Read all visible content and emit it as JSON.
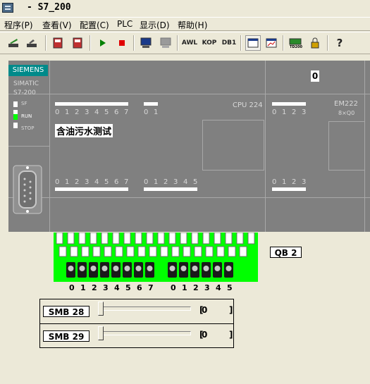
{
  "window": {
    "title": "- S7_200"
  },
  "menu": [
    {
      "label": "程序(P)"
    },
    {
      "label": "查看(V)"
    },
    {
      "label": "配置(C)"
    },
    {
      "label": "PLC"
    },
    {
      "label": "显示(D)"
    },
    {
      "label": "帮助(H)"
    }
  ],
  "toolbar": {
    "awl": "AWL",
    "kop": "KOP",
    "db1": "DB1",
    "td": "TD200",
    "help": "?"
  },
  "plc": {
    "brand": "SIEMENS",
    "model_line1": "SIMATIC",
    "model_line2": "S7-200",
    "status": {
      "sf": "SF",
      "run": "RUN",
      "stop": "STOP"
    },
    "cpu": "CPU 224",
    "program_name": "含油污水测试",
    "inputs_group1": [
      "0",
      "1",
      "2",
      "3",
      "4",
      "5",
      "6",
      "7"
    ],
    "inputs_group2": [
      "0",
      "1"
    ],
    "outputs_group1": [
      "0",
      "1",
      "2",
      "3",
      "4",
      "5",
      "6",
      "7"
    ],
    "outputs_group2": [
      "0",
      "1",
      "2",
      "3",
      "4",
      "5"
    ],
    "em": {
      "name": "EM222",
      "sub": "8×Q0",
      "value": "0",
      "top_bits": [
        "0",
        "1",
        "2",
        "3"
      ],
      "bottom_bits": [
        "0",
        "1",
        "2",
        "3"
      ]
    }
  },
  "output_module": {
    "label": "QB 2",
    "bits_group1": [
      "0",
      "1",
      "2",
      "3",
      "4",
      "5",
      "6",
      "7"
    ],
    "bits_group2": [
      "0",
      "1",
      "2",
      "3",
      "4",
      "5"
    ]
  },
  "smb": [
    {
      "label": "SMB 28",
      "value": "0",
      "close": "]"
    },
    {
      "label": "SMB 29",
      "value": "0",
      "close": "]"
    }
  ]
}
